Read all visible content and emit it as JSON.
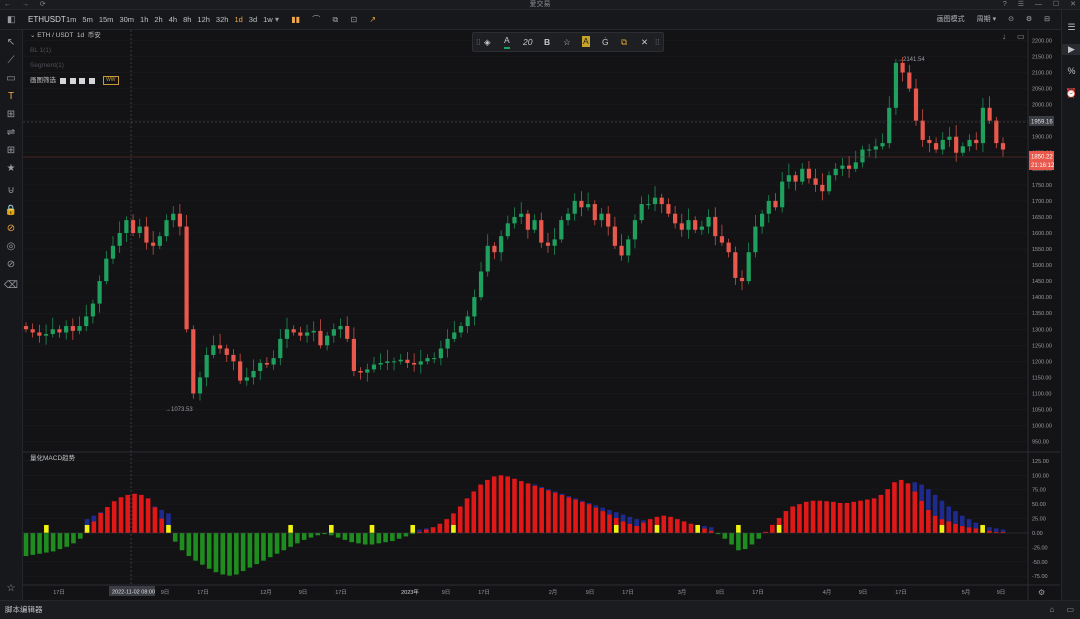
{
  "window": {
    "title": "爱交易",
    "nav": [
      "←",
      "→",
      "⟳"
    ],
    "controls": [
      "?",
      "☰",
      "—",
      "☐",
      "✕"
    ]
  },
  "toolbar": {
    "symbol": "ETHUSDT",
    "timeframes": [
      "1m",
      "5m",
      "15m",
      "30m",
      "1h",
      "2h",
      "4h",
      "8h",
      "12h",
      "32h",
      "1d",
      "3d",
      "1w"
    ],
    "active_timeframe": "1d",
    "tool_icons": [
      "▾",
      "▮▮",
      "⌒",
      "⧉",
      "⊡",
      "↗"
    ],
    "right_items": [
      "画图模式",
      "周期 ▾",
      "⊙",
      "⚙",
      "⊟"
    ]
  },
  "legend": {
    "pair": "ETH / USDT",
    "interval": "1d",
    "exchange": "币安",
    "line2": "BL 1(1)",
    "line3": "Segment(1)",
    "line4_label": "画图筛选",
    "ww_badge": "WW"
  },
  "floating_toolbar": {
    "items": [
      "⁞⁞",
      "◈",
      "A",
      "20",
      "B",
      "☆",
      "A",
      "Ġ",
      "⧉",
      "✕",
      "⁞⁞"
    ]
  },
  "macd": {
    "label": "量化MACD趋势"
  },
  "price_axis": {
    "ticks": [
      "2200.00",
      "2150.00",
      "2100.00",
      "2050.00",
      "2000.00",
      "1950.00",
      "1900.00",
      "1850.00",
      "1800.00",
      "1750.00",
      "1700.00",
      "1650.00",
      "1600.00",
      "1550.00",
      "1500.00",
      "1450.00",
      "1400.00",
      "1350.00",
      "1300.00",
      "1250.00",
      "1200.00",
      "1150.00",
      "1100.00",
      "1050.00",
      "1000.00",
      "950.00"
    ],
    "crosshair_price": "1959.16",
    "last_price": "1850.22",
    "countdown": "21:16:12",
    "high_label": "→2141.54",
    "low_label": "→1073.53"
  },
  "macd_axis": {
    "ticks": [
      "125.00",
      "100.00",
      "75.00",
      "50.00",
      "25.00",
      "0.00",
      "-25.00",
      "-50.00",
      "-75.00"
    ]
  },
  "time_axis": {
    "ticks": [
      "17日",
      "9日",
      "17日",
      "12月",
      "9日",
      "17日",
      "2023年",
      "9日",
      "17日",
      "2月",
      "9日",
      "17日",
      "3月",
      "9日",
      "17日",
      "4月",
      "9日",
      "17日",
      "5月",
      "9日"
    ],
    "crosshair_time": "2022-11-02 08:00"
  },
  "left_tools": [
    "⊟",
    "↖",
    "⟋",
    "▭",
    "T",
    "⊞",
    "⇌",
    "⊞",
    "★",
    "⊍",
    "🔒",
    "⊘",
    "◎",
    "⊘",
    "⌫",
    "☆"
  ],
  "right_tools": [
    "☰",
    "▶",
    "%",
    "⏰"
  ],
  "bottom": {
    "label": "脚本编辑器",
    "icons": [
      "⌂",
      "▭"
    ]
  },
  "colors": {
    "up": "#1fa05e",
    "down": "#e8584c",
    "macd_green": "#1e8c1e",
    "macd_red": "#e01818",
    "macd_yellow": "#f1f114",
    "macd_navy": "#1e2a8c",
    "accent": "#f0a64a"
  },
  "chart_data": {
    "type": "candlestick",
    "ylim": [
      930,
      2220
    ],
    "closes": [
      1300,
      1290,
      1280,
      1285,
      1300,
      1290,
      1310,
      1295,
      1310,
      1340,
      1380,
      1450,
      1520,
      1560,
      1600,
      1640,
      1600,
      1620,
      1570,
      1560,
      1590,
      1640,
      1660,
      1620,
      1300,
      1100,
      1150,
      1220,
      1250,
      1240,
      1220,
      1200,
      1140,
      1150,
      1170,
      1195,
      1190,
      1210,
      1270,
      1300,
      1290,
      1280,
      1290,
      1295,
      1250,
      1280,
      1300,
      1310,
      1270,
      1170,
      1165,
      1175,
      1190,
      1195,
      1200,
      1200,
      1205,
      1195,
      1190,
      1200,
      1210,
      1210,
      1240,
      1270,
      1290,
      1310,
      1340,
      1400,
      1480,
      1560,
      1540,
      1590,
      1630,
      1650,
      1660,
      1610,
      1640,
      1570,
      1560,
      1580,
      1640,
      1660,
      1700,
      1680,
      1690,
      1640,
      1660,
      1620,
      1560,
      1530,
      1580,
      1640,
      1690,
      1690,
      1710,
      1690,
      1660,
      1630,
      1610,
      1640,
      1610,
      1620,
      1650,
      1590,
      1570,
      1540,
      1460,
      1450,
      1540,
      1620,
      1660,
      1700,
      1680,
      1760,
      1780,
      1760,
      1800,
      1770,
      1750,
      1730,
      1780,
      1800,
      1810,
      1800,
      1820,
      1860,
      1860,
      1870,
      1880,
      1990,
      2130,
      2100,
      2050,
      1950,
      1890,
      1880,
      1860,
      1890,
      1900,
      1850,
      1870,
      1890,
      1880,
      1990,
      1950,
      1880,
      1860
    ],
    "opens": [
      1310,
      1300,
      1290,
      1280,
      1285,
      1300,
      1290,
      1310,
      1295,
      1310,
      1340,
      1380,
      1450,
      1520,
      1560,
      1600,
      1640,
      1600,
      1620,
      1570,
      1560,
      1590,
      1640,
      1660,
      1620,
      1300,
      1100,
      1150,
      1220,
      1250,
      1240,
      1220,
      1200,
      1140,
      1150,
      1170,
      1195,
      1190,
      1210,
      1270,
      1300,
      1290,
      1280,
      1290,
      1295,
      1250,
      1280,
      1300,
      1310,
      1270,
      1170,
      1165,
      1175,
      1190,
      1195,
      1200,
      1200,
      1205,
      1195,
      1190,
      1200,
      1210,
      1210,
      1240,
      1270,
      1290,
      1310,
      1340,
      1400,
      1480,
      1560,
      1540,
      1590,
      1630,
      1650,
      1660,
      1610,
      1640,
      1570,
      1560,
      1580,
      1640,
      1660,
      1700,
      1680,
      1690,
      1640,
      1660,
      1620,
      1560,
      1530,
      1580,
      1640,
      1690,
      1690,
      1710,
      1690,
      1660,
      1630,
      1610,
      1640,
      1610,
      1620,
      1650,
      1590,
      1570,
      1540,
      1460,
      1450,
      1540,
      1620,
      1660,
      1700,
      1680,
      1760,
      1780,
      1760,
      1800,
      1770,
      1750,
      1730,
      1780,
      1800,
      1810,
      1800,
      1820,
      1860,
      1860,
      1870,
      1880,
      1990,
      2130,
      2100,
      2050,
      1950,
      1890,
      1880,
      1860,
      1890,
      1900,
      1850,
      1870,
      1890,
      1880,
      1990,
      1950,
      1880
    ],
    "macd_hist": [
      -40,
      -38,
      -36,
      -34,
      -32,
      -28,
      -24,
      -18,
      -10,
      5,
      20,
      35,
      45,
      55,
      62,
      66,
      68,
      66,
      60,
      45,
      25,
      5,
      -15,
      -30,
      -40,
      -48,
      -55,
      -62,
      -68,
      -72,
      -74,
      -72,
      -66,
      -60,
      -54,
      -48,
      -42,
      -36,
      -30,
      -24,
      -18,
      -12,
      -8,
      -4,
      -2,
      -4,
      -8,
      -12,
      -16,
      -18,
      -20,
      -20,
      -18,
      -16,
      -14,
      -10,
      -6,
      -2,
      2,
      6,
      10,
      16,
      24,
      34,
      46,
      60,
      72,
      84,
      92,
      98,
      100,
      98,
      94,
      90,
      86,
      82,
      78,
      74,
      70,
      66,
      62,
      58,
      54,
      50,
      44,
      38,
      32,
      26,
      20,
      16,
      12,
      18,
      24,
      28,
      30,
      28,
      24,
      20,
      16,
      12,
      8,
      4,
      -2,
      -10,
      -20,
      -30,
      -28,
      -20,
      -10,
      2,
      14,
      26,
      38,
      46,
      50,
      54,
      56,
      56,
      55,
      54,
      52,
      52,
      54,
      56,
      58,
      60,
      66,
      76,
      88,
      92,
      86,
      72,
      56,
      40,
      30,
      24,
      20,
      16,
      12,
      10,
      8,
      6,
      4,
      2,
      2
    ],
    "macd_signal": [
      30,
      28,
      26,
      24,
      22,
      20,
      18,
      18,
      20,
      24,
      30,
      36,
      40,
      44,
      48,
      50,
      52,
      52,
      50,
      46,
      40,
      34,
      28,
      22,
      16,
      8,
      0,
      -8,
      -16,
      -24,
      -32,
      -38,
      -42,
      -44,
      -44,
      -42,
      -40,
      -38,
      -34,
      -30,
      -26,
      -22,
      -18,
      -14,
      -10,
      -8,
      -6,
      -6,
      -6,
      -6,
      -6,
      -6,
      -6,
      -4,
      -2,
      0,
      2,
      4,
      6,
      8,
      10,
      12,
      16,
      22,
      30,
      40,
      50,
      60,
      68,
      76,
      82,
      86,
      88,
      88,
      86,
      84,
      80,
      76,
      72,
      68,
      64,
      60,
      56,
      52,
      48,
      44,
      40,
      36,
      32,
      28,
      24,
      22,
      22,
      22,
      22,
      22,
      20,
      18,
      16,
      14,
      12,
      10,
      8,
      4,
      0,
      -4,
      -6,
      -6,
      -4,
      0,
      6,
      12,
      20,
      28,
      34,
      40,
      44,
      48,
      50,
      52,
      52,
      52,
      52,
      52,
      54,
      56,
      58,
      62,
      70,
      80,
      86,
      88,
      84,
      76,
      66,
      56,
      46,
      38,
      30,
      24,
      18,
      14,
      10,
      8,
      6,
      4,
      3
    ]
  }
}
